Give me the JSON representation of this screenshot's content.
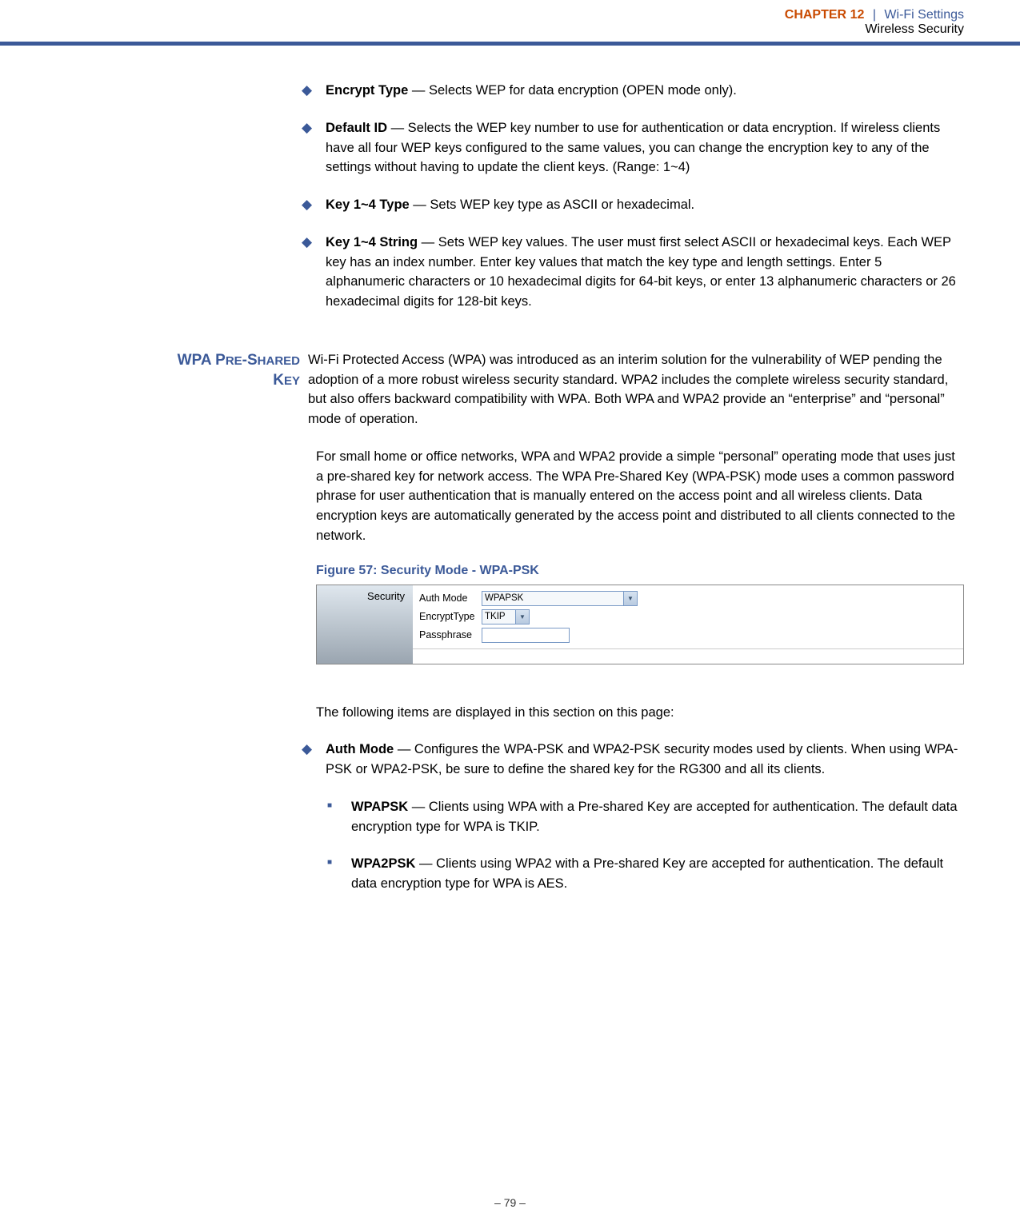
{
  "header": {
    "chapter_word": "CHAPTER",
    "chapter_num": "12",
    "sep": "|",
    "title": "Wi-Fi Settings",
    "subtitle": "Wireless Security"
  },
  "bullets": [
    {
      "bold": "Encrypt Type",
      "text": " — Selects WEP for data encryption (OPEN mode only)."
    },
    {
      "bold": "Default ID",
      "text": " — Selects the WEP key number to use for authentication or data encryption. If wireless clients have all four WEP keys configured to the same values, you can change the encryption key to any of the settings without having to update the client keys. (Range: 1~4)"
    },
    {
      "bold": "Key 1~4 Type",
      "text": " — Sets WEP key type as ASCII or hexadecimal."
    },
    {
      "bold": "Key 1~4 String",
      "text": " — Sets WEP key values. The user must first select ASCII or hexadecimal keys. Each WEP key has an index number. Enter key values that match the key type and length settings. Enter 5 alphanumeric characters or 10 hexadecimal digits for 64-bit keys, or enter 13 alphanumeric characters or 26 hexadecimal digits for 128-bit keys."
    }
  ],
  "section": {
    "label_big1": "WPA P",
    "label_sc1": "RE",
    "label_dash": "-S",
    "label_sc2": "HARED",
    "label_big2": "K",
    "label_sc3": "EY",
    "para1": "Wi-Fi Protected Access (WPA) was introduced as an interim solution for the vulnerability of WEP pending the adoption of a more robust wireless security standard. WPA2 includes the complete wireless security standard, but also offers backward compatibility with WPA. Both WPA and WPA2 provide an “enterprise” and “personal” mode of operation.",
    "para2": "For small home or office networks, WPA and WPA2 provide a simple “personal” operating mode that uses just a pre-shared key for network access. The WPA Pre-Shared Key (WPA-PSK) mode uses a common password phrase for user authentication that is manually entered on the access point and all wireless clients. Data encryption keys are automatically generated by the access point and distributed to all clients connected to the network."
  },
  "figure": {
    "caption": "Figure 57:  Security Mode - WPA-PSK",
    "panel_title": "Security",
    "rows": {
      "auth": {
        "label": "Auth Mode",
        "value": "WPAPSK"
      },
      "encrypt": {
        "label": "EncryptType",
        "value": "TKIP"
      },
      "pass": {
        "label": "Passphrase"
      }
    }
  },
  "after_fig": "The following items are displayed in this section on this page:",
  "auth_bullet": {
    "bold": "Auth Mode",
    "text": " — Configures the WPA-PSK and WPA2-PSK security modes used by clients. When using WPA-PSK or WPA2-PSK, be sure to define the shared key for the RG300 and all its clients."
  },
  "sub_bullets": [
    {
      "bold": "WPAPSK",
      "text": " — Clients using WPA with a Pre-shared Key are accepted for authentication. The default data encryption type for WPA is TKIP."
    },
    {
      "bold": "WPA2PSK",
      "text": " — Clients using WPA2 with a Pre-shared Key are accepted for authentication. The default data encryption type for WPA is AES."
    }
  ],
  "footer": "–  79  –"
}
